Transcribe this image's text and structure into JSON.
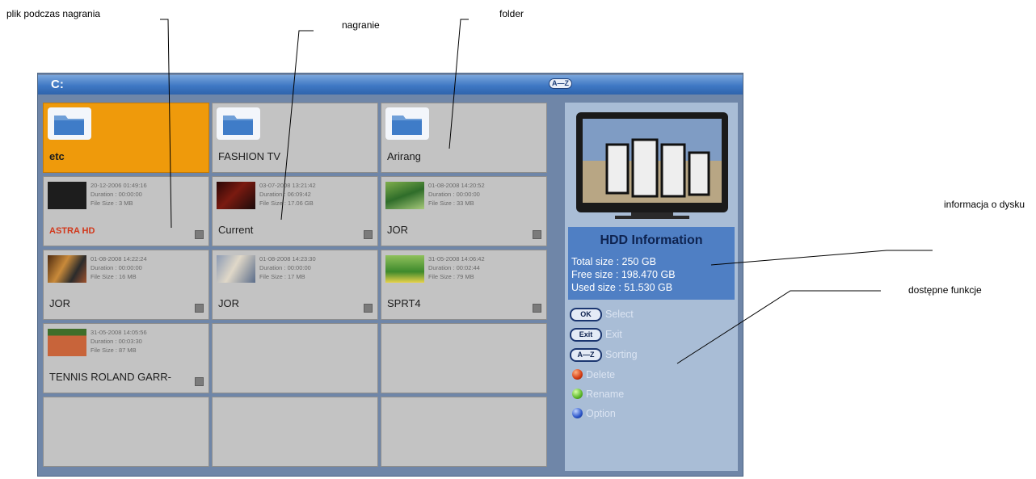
{
  "annotations": {
    "recording_in_progress": "plik podczas nagrania",
    "recording": "nagranie",
    "folder": "folder",
    "disk_info": "informacja o dysku",
    "functions": "dostępne funkcje"
  },
  "header": {
    "drive": "C:",
    "sort_badge": "A—Z"
  },
  "cells": [
    {
      "type": "folder",
      "name": "etc",
      "selected": true
    },
    {
      "type": "folder",
      "name": "FASHION TV"
    },
    {
      "type": "folder",
      "name": "Arirang"
    },
    {
      "type": "file",
      "name": "ASTRA HD",
      "date": "20-12-2006 01:49:16",
      "duration": "Duration : 00:00:00",
      "size": "File Size : 3 MB",
      "recording": true
    },
    {
      "type": "file",
      "name": "Current",
      "date": "03-07-2008 13:21:42",
      "duration": "Duration : 06:09:42",
      "size": "File Size : 17.06 GB"
    },
    {
      "type": "file",
      "name": "JOR",
      "date": "01-08-2008 14:20:52",
      "duration": "Duration : 00:00:00",
      "size": "File Size : 33 MB"
    },
    {
      "type": "file",
      "name": "JOR",
      "date": "01-08-2008 14:22:24",
      "duration": "Duration : 00:00:00",
      "size": "File Size : 16 MB"
    },
    {
      "type": "file",
      "name": "JOR",
      "date": "01-08-2008 14:23:30",
      "duration": "Duration : 00:00:00",
      "size": "File Size : 17 MB"
    },
    {
      "type": "file",
      "name": "SPRT4",
      "date": "31-05-2008 14:06:42",
      "duration": "Duration : 00:02:44",
      "size": "File Size : 79 MB"
    },
    {
      "type": "file",
      "name": "TENNIS ROLAND GARR-",
      "date": "31-05-2008 14:05:56",
      "duration": "Duration : 00:03:30",
      "size": "File Size : 87 MB"
    }
  ],
  "hdd": {
    "title": "HDD Information",
    "total": "Total size : 250 GB",
    "free": "Free size : 198.470 GB",
    "used": "Used size : 51.530 GB"
  },
  "functions": [
    {
      "key": "OK",
      "label": "Select",
      "icon": "ok-key-icon"
    },
    {
      "key": "Exit",
      "label": "Exit",
      "icon": "exit-key-icon"
    },
    {
      "key": "A—Z",
      "label": "Sorting",
      "icon": "az-key-icon"
    },
    {
      "label": "Delete",
      "icon": "red-button-icon",
      "color": "#d33b13"
    },
    {
      "label": "Rename",
      "icon": "green-button-icon",
      "color": "#5cb82a"
    },
    {
      "label": "Option",
      "icon": "blue-button-icon",
      "color": "#2c55c9"
    }
  ]
}
